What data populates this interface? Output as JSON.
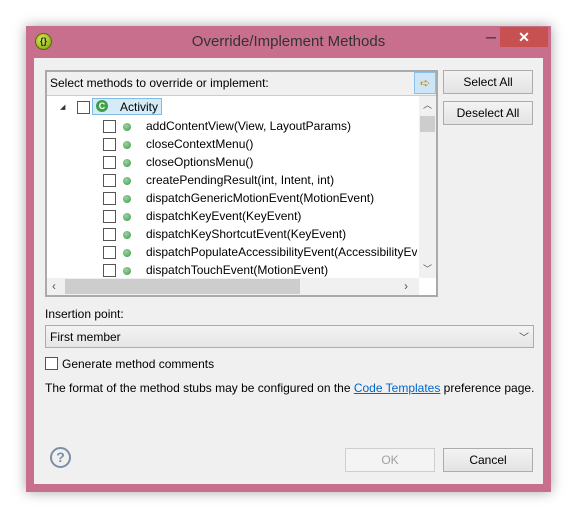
{
  "window": {
    "title": "Override/Implement Methods",
    "minimize": "─",
    "maximize": "☐",
    "close": "✕"
  },
  "tree_panel": {
    "header": "Select methods to override or implement:",
    "toggle_icon": "➪"
  },
  "tree": {
    "root": "Activity",
    "root_icon": "C",
    "methods": [
      "addContentView(View, LayoutParams)",
      "closeContextMenu()",
      "closeOptionsMenu()",
      "createPendingResult(int, Intent, int)",
      "dispatchGenericMotionEvent(MotionEvent)",
      "dispatchKeyEvent(KeyEvent)",
      "dispatchKeyShortcutEvent(KeyEvent)",
      "dispatchPopulateAccessibilityEvent(AccessibilityEvent)",
      "dispatchTouchEvent(MotionEvent)"
    ]
  },
  "buttons": {
    "select_all": "Select All",
    "deselect_all": "Deselect All",
    "ok": "OK",
    "cancel": "Cancel"
  },
  "insertion": {
    "label": "Insertion point:",
    "value": "First member"
  },
  "generate_comments": {
    "label": "Generate method comments",
    "checked": false
  },
  "info": {
    "before": "The format of the method stubs may be configured on the ",
    "link": "Code Templates",
    "after": " preference page."
  },
  "help": "?",
  "colors": {
    "frame": "#c86f8e",
    "close": "#c75050",
    "link": "#0066cc"
  }
}
